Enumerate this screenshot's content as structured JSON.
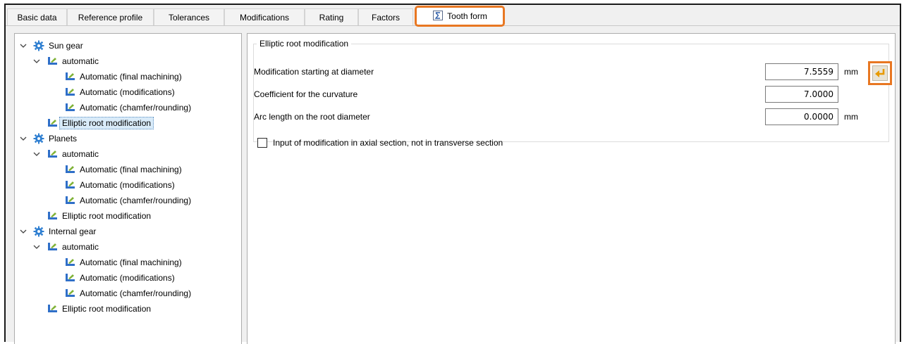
{
  "tabs": [
    {
      "label": "Basic data"
    },
    {
      "label": "Reference profile"
    },
    {
      "label": "Tolerances"
    },
    {
      "label": "Modifications"
    },
    {
      "label": "Rating"
    },
    {
      "label": "Factors"
    },
    {
      "label": "Tooth form",
      "active": true
    }
  ],
  "tree": {
    "sun": {
      "label": "Sun gear",
      "auto_label": "automatic",
      "final": "Automatic (final machining)",
      "mods": "Automatic (modifications)",
      "chamfer": "Automatic (chamfer/rounding)",
      "elliptic": "Elliptic root modification"
    },
    "planets": {
      "label": "Planets",
      "auto_label": "automatic",
      "final": "Automatic (final machining)",
      "mods": "Automatic (modifications)",
      "chamfer": "Automatic (chamfer/rounding)",
      "elliptic": "Elliptic root modification"
    },
    "internal": {
      "label": "Internal gear",
      "auto_label": "automatic",
      "final": "Automatic (final machining)",
      "mods": "Automatic (modifications)",
      "chamfer": "Automatic (chamfer/rounding)",
      "elliptic": "Elliptic root modification"
    },
    "selected": "sun.elliptic"
  },
  "panel": {
    "title": "Elliptic root modification",
    "fields": [
      {
        "label": "Modification starting at diameter",
        "value": "7.5559",
        "unit": "mm"
      },
      {
        "label": "Coefficient for the curvature",
        "value": "7.0000",
        "unit": ""
      },
      {
        "label": "Arc length on the root diameter",
        "value": "0.0000",
        "unit": "mm"
      }
    ],
    "checkbox": {
      "label": "Input of modification in axial section, not in transverse section",
      "checked": false
    }
  },
  "colors": {
    "highlight": "#e87722",
    "gear_icon": "#2f7fd1",
    "selection": "#d9ebf9"
  },
  "icons": {
    "gear": "gear-icon",
    "tool": "tool-icon",
    "expander": "chevron-down-icon",
    "fetch": "arrow-left-return-icon",
    "tab_tooth_form": "sigma-document-icon"
  }
}
